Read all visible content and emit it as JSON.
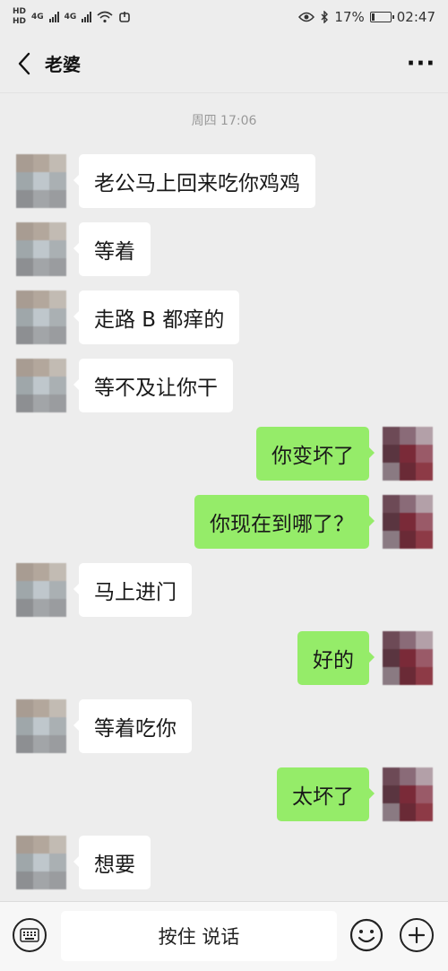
{
  "status_bar": {
    "hd_top": "HD",
    "hd_bottom": "HD",
    "network_1": "4G",
    "network_2": "4G",
    "battery_percent": "17%",
    "battery_level": 0.17,
    "time": "02:47"
  },
  "header": {
    "title": "老婆",
    "more_glyph": "···"
  },
  "timestamp": "周四 17:06",
  "avatar_colors": {
    "contact": [
      "#a89c92",
      "#b3a79c",
      "#c2bbb3",
      "#9fa7aa",
      "#bfc7cc",
      "#aab0b3",
      "#8d8f92",
      "#a2a5a8",
      "#9a9c9f"
    ],
    "self": [
      "#6d4a56",
      "#8a6b78",
      "#b3a0a8",
      "#5a3540",
      "#7a2a38",
      "#9a5a68",
      "#8a7a82",
      "#6a2a36",
      "#8d3a46"
    ]
  },
  "messages": [
    {
      "side": "left",
      "text": "老公马上回来吃你鸡鸡"
    },
    {
      "side": "left",
      "text": "等着"
    },
    {
      "side": "left",
      "text": "走路 B 都痒的"
    },
    {
      "side": "left",
      "text": "等不及让你干"
    },
    {
      "side": "right",
      "text": "你变坏了"
    },
    {
      "side": "right",
      "text": "你现在到哪了？"
    },
    {
      "side": "left",
      "text": "马上进门"
    },
    {
      "side": "right",
      "text": "好的"
    },
    {
      "side": "left",
      "text": "等着吃你"
    },
    {
      "side": "right",
      "text": "太坏了"
    },
    {
      "side": "left",
      "text": "想要"
    }
  ],
  "input_bar": {
    "hold_to_talk": "按住 说话"
  }
}
